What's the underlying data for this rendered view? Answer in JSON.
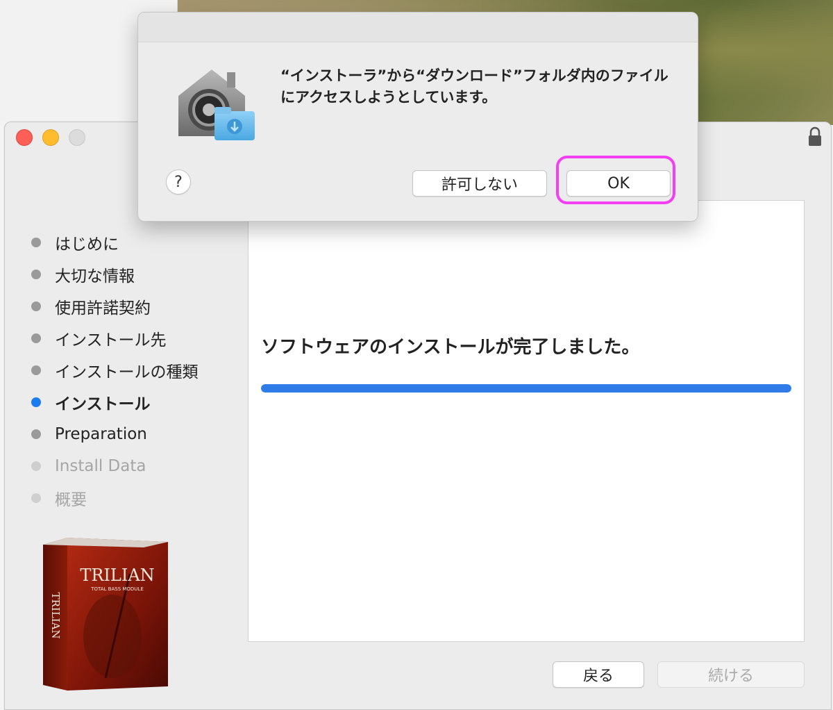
{
  "dialog": {
    "message": "“インストーラ”から“ダウンロード”フォルダ内のファイルにアクセスしようとしています。",
    "help_label": "?",
    "deny_label": "許可しない",
    "ok_label": "OK"
  },
  "sidebar": {
    "steps": [
      {
        "label": "はじめに",
        "state": "done"
      },
      {
        "label": "大切な情報",
        "state": "done"
      },
      {
        "label": "使用許諾契約",
        "state": "done"
      },
      {
        "label": "インストール先",
        "state": "done"
      },
      {
        "label": "インストールの種類",
        "state": "done"
      },
      {
        "label": "インストール",
        "state": "active"
      },
      {
        "label": "Preparation",
        "state": "done"
      },
      {
        "label": "Install Data",
        "state": "pending"
      },
      {
        "label": "概要",
        "state": "pending"
      }
    ]
  },
  "product": {
    "name": "TRILIAN",
    "subtitle": "TOTAL BASS MODULE"
  },
  "content": {
    "message": "ソフトウェアのインストールが完了しました。",
    "progress_percent": 100
  },
  "footer": {
    "back_label": "戻る",
    "continue_label": "続ける"
  },
  "colors": {
    "accent": "#2f7ce8",
    "highlight": "#f23ff2"
  }
}
